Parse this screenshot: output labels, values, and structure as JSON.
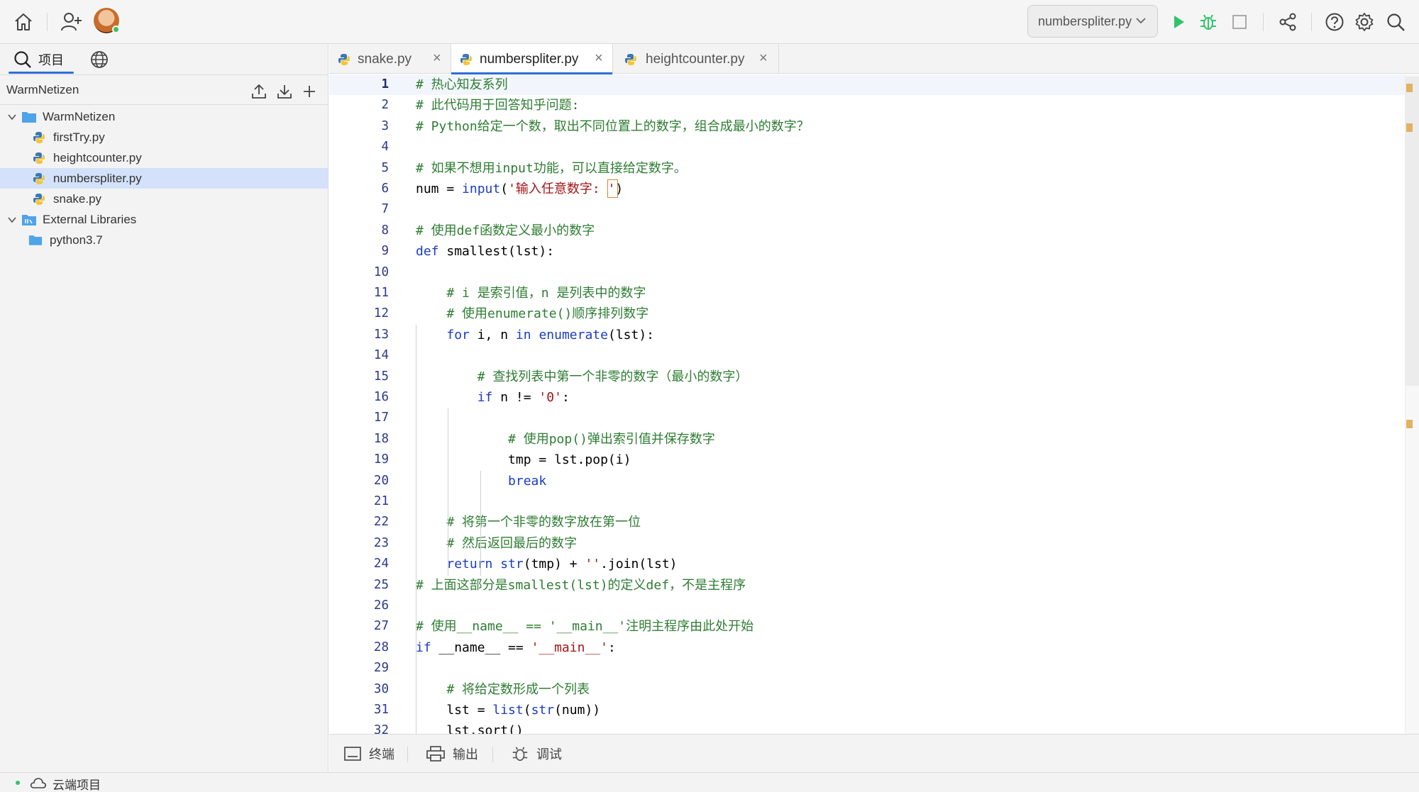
{
  "header": {
    "run_config": "numberspliter.py"
  },
  "left_panel": {
    "tabs": [
      {
        "label": "项目",
        "icon": "search-icon"
      },
      {
        "label": "",
        "icon": "globe-icon"
      }
    ],
    "project_name": "WarmNetizen",
    "tree": [
      {
        "label": "WarmNetizen",
        "type": "folder",
        "expanded": true
      },
      {
        "label": "firstTry.py",
        "type": "python-file"
      },
      {
        "label": "heightcounter.py",
        "type": "python-file"
      },
      {
        "label": "numberspliter.py",
        "type": "python-file",
        "selected": true
      },
      {
        "label": "snake.py",
        "type": "python-file"
      },
      {
        "label": "External Libraries",
        "type": "library-folder",
        "expanded": true
      },
      {
        "label": "python3.7",
        "type": "folder"
      }
    ]
  },
  "editor": {
    "tabs": [
      {
        "label": "snake.py",
        "active": false
      },
      {
        "label": "numberspliter.py",
        "active": true
      },
      {
        "label": "heightcounter.py",
        "active": false
      }
    ],
    "close_glyph": "×",
    "current_line": 1,
    "lines": [
      {
        "n": "1",
        "text": "# 热心知友系列"
      },
      {
        "n": "2",
        "text": "# 此代码用于回答知乎问题:"
      },
      {
        "n": "3",
        "text": "# Python给定一个数，取出不同位置上的数字，组合成最小的数字？"
      },
      {
        "n": "4",
        "text": ""
      },
      {
        "n": "5",
        "text": "# 如果不想用input功能，可以直接给定数字。"
      },
      {
        "n": "6",
        "text": "num = input('输入任意数字: ')"
      },
      {
        "n": "7",
        "text": ""
      },
      {
        "n": "8",
        "text": "# 使用def函数定义最小的数字"
      },
      {
        "n": "9",
        "text": "def smallest(lst):"
      },
      {
        "n": "10",
        "text": ""
      },
      {
        "n": "11",
        "text": "    # i 是索引值，n 是列表中的数字"
      },
      {
        "n": "12",
        "text": "    # 使用enumerate()顺序排列数字"
      },
      {
        "n": "13",
        "text": "    for i, n in enumerate(lst):"
      },
      {
        "n": "14",
        "text": ""
      },
      {
        "n": "15",
        "text": "        # 查找列表中第一个非零的数字（最小的数字）"
      },
      {
        "n": "16",
        "text": "        if n != '0':"
      },
      {
        "n": "17",
        "text": ""
      },
      {
        "n": "18",
        "text": "            # 使用pop()弹出索引值并保存数字"
      },
      {
        "n": "19",
        "text": "            tmp = lst.pop(i)"
      },
      {
        "n": "20",
        "text": "            break"
      },
      {
        "n": "21",
        "text": ""
      },
      {
        "n": "22",
        "text": "    # 将第一个非零的数字放在第一位"
      },
      {
        "n": "23",
        "text": "    # 然后返回最后的数字"
      },
      {
        "n": "24",
        "text": "    return str(tmp) + ''.join(lst)"
      },
      {
        "n": "25",
        "text": "# 上面这部分是smallest(lst)的定义def，不是主程序"
      },
      {
        "n": "26",
        "text": ""
      },
      {
        "n": "27",
        "text": "# 使用__name__ == '__main__'注明主程序由此处开始"
      },
      {
        "n": "28",
        "text": "if __name__ == '__main__':"
      },
      {
        "n": "29",
        "text": ""
      },
      {
        "n": "30",
        "text": "    # 将给定数形成一个列表"
      },
      {
        "n": "31",
        "text": "    lst = list(str(num))"
      },
      {
        "n": "32",
        "text": "    lst.sort()"
      }
    ]
  },
  "bottom_panel": {
    "items": [
      {
        "label": "终端",
        "icon": "terminal-icon"
      },
      {
        "label": "输出",
        "icon": "printer-icon"
      },
      {
        "label": "调试",
        "icon": "bug-icon"
      }
    ]
  },
  "status_bar": {
    "label": "云端项目",
    "icon": "cloud-icon"
  },
  "colors": {
    "accent": "#2e6fd6",
    "selection": "#d3e2fa",
    "comment": "#2e7d32",
    "keyword": "#1a3cc8",
    "string": "#a31515",
    "run_green": "#2fc46a"
  }
}
